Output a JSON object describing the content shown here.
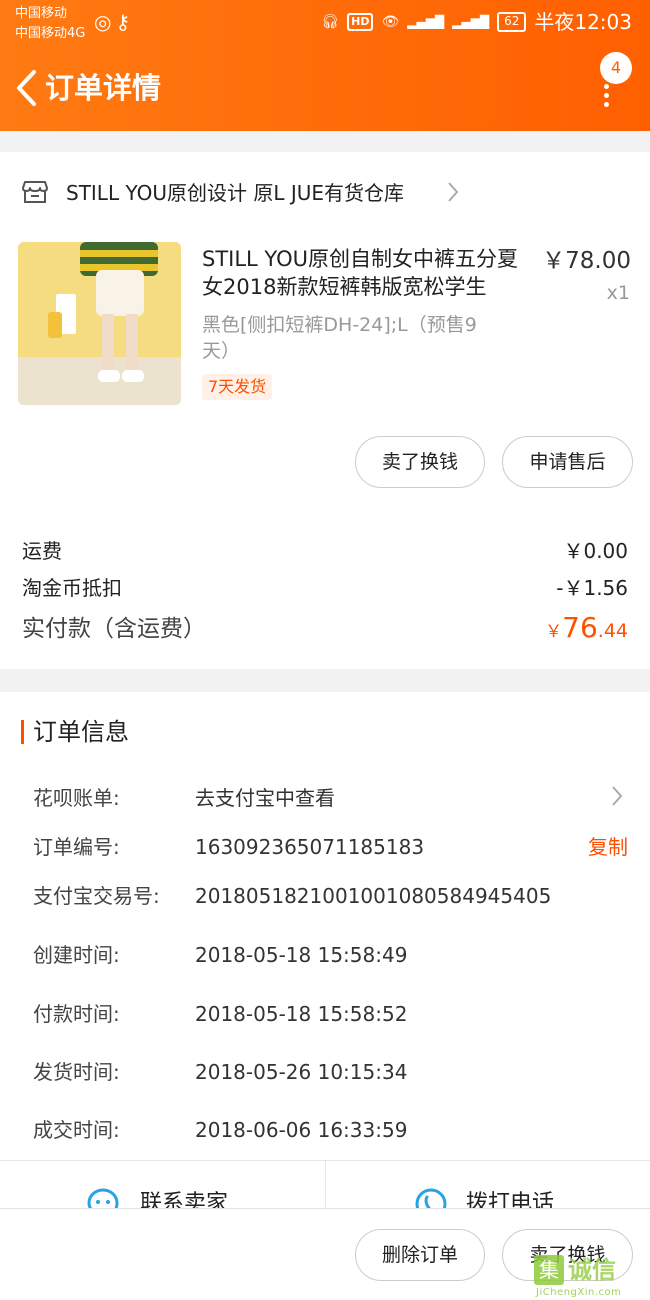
{
  "status_bar": {
    "carrier1": "中国移动",
    "carrier2": "中国移动4G",
    "battery": "62",
    "time": "半夜12:03"
  },
  "header": {
    "title": "订单详情",
    "badge_count": "4"
  },
  "shop": {
    "name": "STILL YOU原创设计  原L JUE有货仓库"
  },
  "product": {
    "title": "STILL YOU原创自制女中裤五分夏女2018新款短裤韩版宽松学生",
    "price": "￥78.00",
    "quantity": "x1",
    "sku": "黑色[侧扣短裤DH-24];L（预售9天）",
    "ship_tag": "7天发货"
  },
  "actions": {
    "sell": "卖了换钱",
    "after_sale": "申请售后"
  },
  "fees": [
    {
      "label": "运费",
      "value": "￥0.00"
    },
    {
      "label": "淘金币抵扣",
      "value": "-￥1.56"
    }
  ],
  "paid": {
    "label": "实付款（含运费）",
    "currency": "￥",
    "integer": "76",
    "decimal": ".44"
  },
  "order_info": {
    "title": "订单信息",
    "copy_label": "复制",
    "rows": [
      {
        "label": "花呗账单:",
        "value": "去支付宝中查看"
      },
      {
        "label": "订单编号:",
        "value": "163092365071185183"
      },
      {
        "label": "支付宝交易号:",
        "value": "2018051821001001080584945405"
      },
      {
        "label": "创建时间:",
        "value": "2018-05-18 15:58:49"
      },
      {
        "label": "付款时间:",
        "value": "2018-05-18 15:58:52"
      },
      {
        "label": "发货时间:",
        "value": "2018-05-26 10:15:34"
      },
      {
        "label": "成交时间:",
        "value": "2018-06-06 16:33:59"
      }
    ]
  },
  "contact": {
    "seller": "联系卖家",
    "phone": "拨打电话"
  },
  "bottom": {
    "delete": "删除订单",
    "sell": "卖了换钱"
  },
  "watermark": {
    "mark": "集",
    "text": "诚信",
    "url": "JiChengXin.com"
  },
  "colors": {
    "header_start": "#ff7a12",
    "header_end": "#ff5f00",
    "accent": "#ff5000"
  }
}
